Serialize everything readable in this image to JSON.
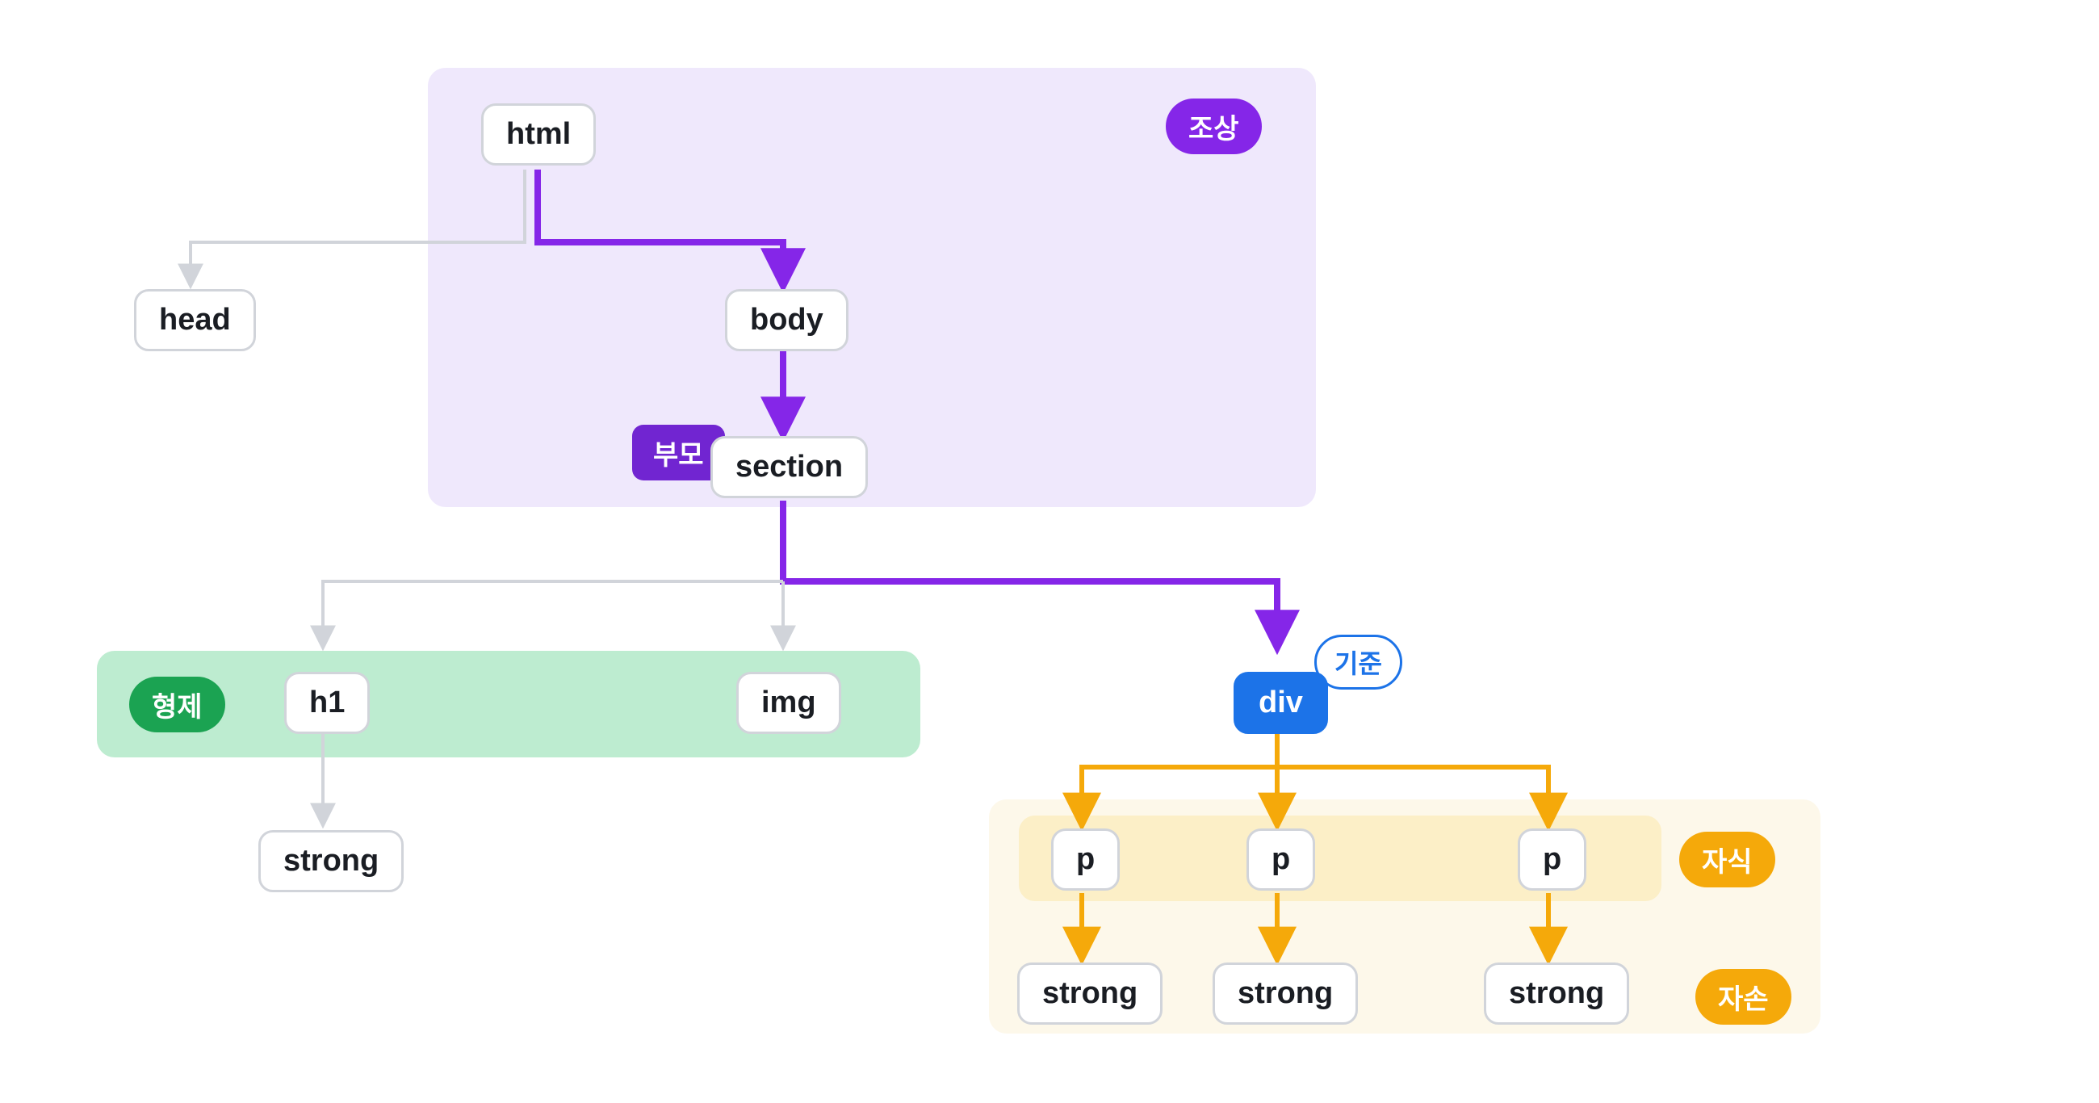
{
  "labels": {
    "ancestor": "조상",
    "parent": "부모",
    "sibling": "형제",
    "reference": "기준",
    "children": "자식",
    "descendant": "자손"
  },
  "nodes": {
    "html": "html",
    "head": "head",
    "body": "body",
    "section": "section",
    "h1": "h1",
    "img": "img",
    "div": "div",
    "strong_h1": "strong",
    "p1": "p",
    "p2": "p",
    "p3": "p",
    "strong_p1": "strong",
    "strong_p2": "strong",
    "strong_p3": "strong"
  },
  "colors": {
    "purple": "#8526E8",
    "purple_light": "#EFE8FC",
    "green": "#1BA352",
    "green_light": "#BDECD0",
    "orange": "#F5A90A",
    "orange_light": "#FCEFC7",
    "cream": "#FDF8EA",
    "blue": "#1C73E8",
    "gray": "#D1D4DA"
  }
}
